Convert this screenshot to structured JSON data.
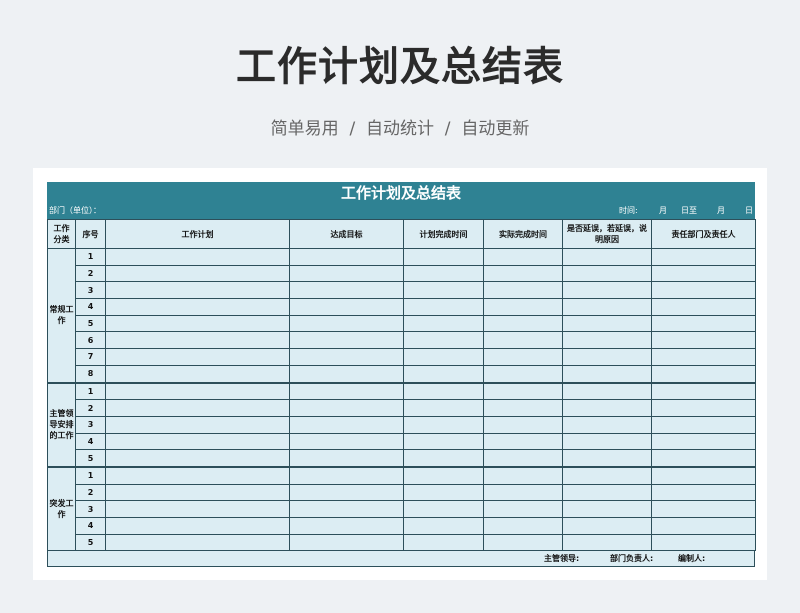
{
  "page": {
    "title": "工作计划及总结表",
    "subtitle": "简单易用  /  自动统计  /  自动更新"
  },
  "sheet": {
    "title": "工作计划及总结表",
    "dept_label": "部门（单位）：",
    "time_label": "时间:",
    "time_month1": "月",
    "time_day_to": "日至",
    "time_month2": "月",
    "time_day": "日"
  },
  "table": {
    "headers": [
      "工作分类",
      "序号",
      "工作计划",
      "达成目标",
      "计划完成时间",
      "实际完成时间",
      "是否延误，若延误，说明原因",
      "责任部门及责任人"
    ],
    "groups": [
      {
        "category": "常规工作",
        "rows": [
          "1",
          "2",
          "3",
          "4",
          "5",
          "6",
          "7",
          "8"
        ]
      },
      {
        "category": "主管领导安排的工作",
        "rows": [
          "1",
          "2",
          "3",
          "4",
          "5"
        ]
      },
      {
        "category": "突发工作",
        "rows": [
          "1",
          "2",
          "3",
          "4",
          "5"
        ]
      }
    ]
  },
  "footer": {
    "supervisor": "主管领导:",
    "dept_head": "部门负责人:",
    "preparer": "编制人:"
  },
  "colors": {
    "header_bg": "#2f8293",
    "cell_bg": "#dcedf3",
    "border": "#2d4f5a"
  }
}
